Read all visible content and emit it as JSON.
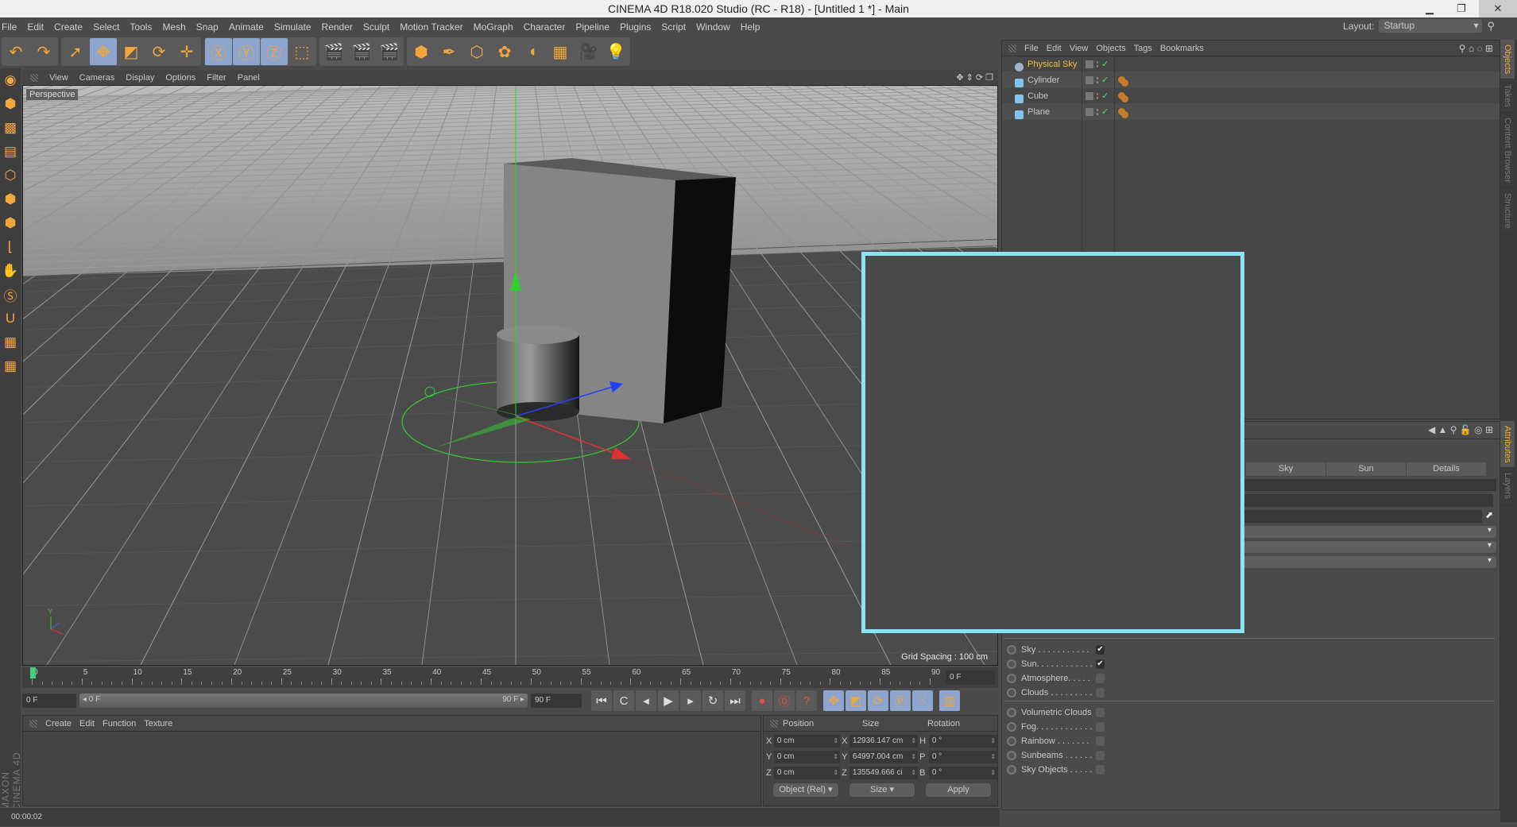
{
  "window": {
    "title": "CINEMA 4D R18.020 Studio (RC - R18) - [Untitled 1 *] - Main",
    "minimize": "▁",
    "maximize": "❐",
    "close": "✕"
  },
  "menu": [
    "File",
    "Edit",
    "Create",
    "Select",
    "Tools",
    "Mesh",
    "Snap",
    "Animate",
    "Simulate",
    "Render",
    "Sculpt",
    "Motion Tracker",
    "MoGraph",
    "Character",
    "Pipeline",
    "Plugins",
    "Script",
    "Window",
    "Help"
  ],
  "layout": {
    "label": "Layout:",
    "value": "Startup"
  },
  "toolbar": {
    "groups": [
      [
        {
          "icon": "undo-icon",
          "glyph": "↶",
          "on": false
        },
        {
          "icon": "redo-icon",
          "glyph": "↷",
          "on": false
        }
      ],
      [
        {
          "icon": "live-selection-icon",
          "glyph": "➚",
          "on": false
        },
        {
          "icon": "move-icon",
          "glyph": "✥",
          "on": true
        },
        {
          "icon": "scale-icon",
          "glyph": "◩",
          "on": false
        },
        {
          "icon": "rotate-icon",
          "glyph": "⟳",
          "on": false
        },
        {
          "icon": "recent-tool-icon",
          "glyph": "✛",
          "on": false
        }
      ],
      [
        {
          "icon": "x-axis-icon",
          "glyph": "Ⓧ",
          "on": true
        },
        {
          "icon": "y-axis-icon",
          "glyph": "Ⓨ",
          "on": true
        },
        {
          "icon": "z-axis-icon",
          "glyph": "Ⓩ",
          "on": true
        },
        {
          "icon": "coordinate-system-icon",
          "glyph": "⬚",
          "on": false
        }
      ],
      [
        {
          "icon": "render-view-icon",
          "glyph": "🎬",
          "on": false
        },
        {
          "icon": "render-picture-viewer-icon",
          "glyph": "🎬",
          "on": false
        },
        {
          "icon": "render-settings-icon",
          "glyph": "🎬",
          "on": false
        }
      ],
      [
        {
          "icon": "cube-primitive-icon",
          "glyph": "⬢",
          "on": false
        },
        {
          "icon": "pen-spline-icon",
          "glyph": "✒",
          "on": false
        },
        {
          "icon": "subdivision-surface-icon",
          "glyph": "⬡",
          "on": false
        },
        {
          "icon": "cloner-icon",
          "glyph": "✿",
          "on": false
        },
        {
          "icon": "deformer-icon",
          "glyph": "◖",
          "on": false
        },
        {
          "icon": "floor-environment-icon",
          "glyph": "▦",
          "on": false
        },
        {
          "icon": "camera-icon",
          "glyph": "🎥",
          "on": false
        },
        {
          "icon": "light-icon",
          "glyph": "💡",
          "on": false
        }
      ]
    ]
  },
  "left_tools": [
    {
      "icon": "make-editable-icon",
      "glyph": "◉"
    },
    {
      "icon": "model-mode-icon",
      "glyph": "⬢"
    },
    {
      "icon": "texture-mode-icon",
      "glyph": "▩"
    },
    {
      "icon": "workplane-icon",
      "glyph": "▤"
    },
    {
      "icon": "points-mode-icon",
      "glyph": "⬡"
    },
    {
      "icon": "edges-mode-icon",
      "glyph": "⬢"
    },
    {
      "icon": "polygons-mode-icon",
      "glyph": "⬢"
    },
    {
      "icon": "axis-mode-icon",
      "glyph": "⌊"
    },
    {
      "icon": "tweak-mode-icon",
      "glyph": "✋"
    },
    {
      "icon": "solo-icon",
      "glyph": "Ⓢ"
    },
    {
      "icon": "snap-icon",
      "glyph": "U"
    },
    {
      "icon": "workplane-lock-icon",
      "glyph": "▦"
    },
    {
      "icon": "locked-workplane-icon",
      "glyph": "▦"
    }
  ],
  "viewport": {
    "menu": [
      "View",
      "Cameras",
      "Display",
      "Options",
      "Filter",
      "Panel"
    ],
    "label": "Perspective",
    "grid_spacing": "Grid Spacing : 100 cm",
    "axis_y": "Y"
  },
  "timeline": {
    "ticks": [
      0,
      5,
      10,
      15,
      20,
      25,
      30,
      35,
      40,
      45,
      50,
      55,
      60,
      65,
      70,
      75,
      80,
      85,
      90
    ],
    "current_frame": "0 F",
    "current_fraction": 0
  },
  "transport": {
    "start": "0 F",
    "range_start": "◂ 0 F",
    "range_end": "90 F ▸",
    "end": "90 F",
    "buttons": [
      {
        "icon": "go-to-start-icon",
        "glyph": "⏮"
      },
      {
        "icon": "previous-key-icon",
        "glyph": "C"
      },
      {
        "icon": "previous-frame-icon",
        "glyph": "◂"
      },
      {
        "icon": "play-icon",
        "glyph": "▶"
      },
      {
        "icon": "next-frame-icon",
        "glyph": "▸"
      },
      {
        "icon": "next-key-icon",
        "glyph": "↻"
      },
      {
        "icon": "go-to-end-icon",
        "glyph": "⏭"
      },
      {
        "icon": "record-active-objects-icon",
        "glyph": "●"
      },
      {
        "icon": "autokeying-icon",
        "glyph": "⓪"
      },
      {
        "icon": "keyframe-selection-icon",
        "glyph": "?"
      },
      {
        "icon": "record-position-icon",
        "glyph": "✥"
      },
      {
        "icon": "record-scale-icon",
        "glyph": "◩"
      },
      {
        "icon": "record-rotation-icon",
        "glyph": "⟳"
      },
      {
        "icon": "record-parameter-icon",
        "glyph": "Ⓟ"
      },
      {
        "icon": "record-pla-icon",
        "glyph": "⁙"
      },
      {
        "icon": "timeline-icon",
        "glyph": "▥"
      }
    ]
  },
  "materials": {
    "menu": [
      "Create",
      "Edit",
      "Function",
      "Texture"
    ]
  },
  "coords": {
    "headers": [
      "Position",
      "Size",
      "Rotation"
    ],
    "rows": [
      {
        "axis": "X",
        "pos": "0 cm",
        "size_axis": "X",
        "size": "12936.147 cm",
        "rot_axis": "H",
        "rot": "0 °"
      },
      {
        "axis": "Y",
        "pos": "0 cm",
        "size_axis": "Y",
        "size": "64997.004 cm",
        "rot_axis": "P",
        "rot": "0 °"
      },
      {
        "axis": "Z",
        "pos": "0 cm",
        "size_axis": "Z",
        "size": "135549.666 ci",
        "rot_axis": "B",
        "rot": "0 °"
      }
    ],
    "mode": "Object (Rel) ▾",
    "size_mode": "Size ▾",
    "apply": "Apply"
  },
  "status": "00:00:02",
  "logo": "MAXON CINEMA 4D",
  "object_manager": {
    "menu": [
      "File",
      "Edit",
      "View",
      "Objects",
      "Tags",
      "Bookmarks"
    ],
    "objects": [
      {
        "name": "Physical Sky",
        "color": "#9fb3c8",
        "selected": true,
        "tag": false
      },
      {
        "name": "Cylinder",
        "color": "#7fc3f0",
        "selected": false,
        "tag": true
      },
      {
        "name": "Cube",
        "color": "#7fc3f0",
        "selected": false,
        "tag": true
      },
      {
        "name": "Plane",
        "color": "#7fc3f0",
        "selected": false,
        "tag": true
      }
    ],
    "check": "✓"
  },
  "right_tabs": {
    "top": [
      "Objects",
      "Takes",
      "Content Browser",
      "Structure"
    ],
    "bottom": [
      "Attributes",
      "Layers"
    ]
  },
  "attributes": {
    "tabs": [
      "Sky",
      "Sun",
      "Details"
    ],
    "items": [
      {
        "label": "Sky . . . . . . . . . . .",
        "checked": true
      },
      {
        "label": "Sun. . . . . . . . . . . .",
        "checked": true
      },
      {
        "label": "Atmosphere. . . . .",
        "checked": false
      },
      {
        "label": "Clouds . . . . . . . . .",
        "checked": false
      },
      {
        "label": "Volumetric Clouds",
        "checked": false
      },
      {
        "label": "Fog. . . . . . . . . . . .",
        "checked": false
      },
      {
        "label": "Rainbow . . . . . . .",
        "checked": false
      },
      {
        "label": "Sunbeams . . . . . .",
        "checked": false
      },
      {
        "label": "Sky Objects . . . . .",
        "checked": false
      }
    ],
    "check": "✔"
  },
  "colors": {
    "accent": "#f3a73b",
    "highlight": "#8de3f4",
    "active_tool": "#8ea6cd",
    "axis_x": "#e03030",
    "axis_y": "#2fd12f",
    "axis_z": "#2040ff"
  }
}
